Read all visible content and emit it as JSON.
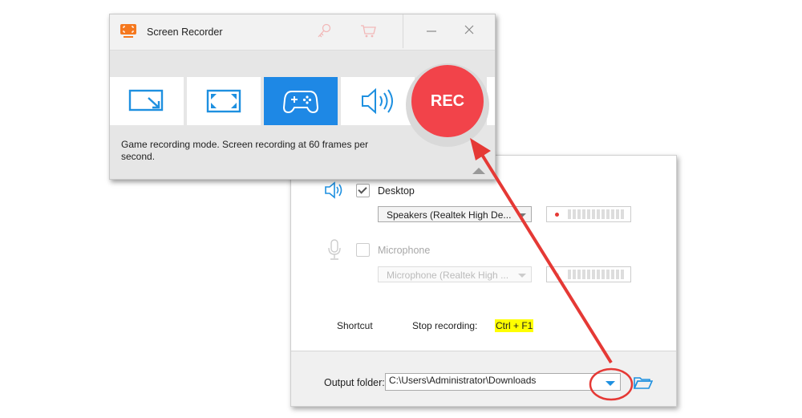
{
  "recorder": {
    "title": "Screen Recorder",
    "app_icon": "screen-recorder-logo-icon",
    "toolbar_icons": [
      "key-icon",
      "cart-icon"
    ],
    "window_controls": [
      "minimize-icon",
      "close-icon"
    ],
    "modes": [
      {
        "name": "region-mode",
        "icon": "resize-region-icon",
        "active": false
      },
      {
        "name": "fullscreen-mode",
        "icon": "fullscreen-icon",
        "active": false
      },
      {
        "name": "game-mode",
        "icon": "gamepad-icon",
        "active": true
      },
      {
        "name": "audio-only-mode",
        "icon": "speaker-icon",
        "active": false
      }
    ],
    "rec_label": "REC",
    "description": "Game recording mode. Screen recording at 60 frames per second.",
    "colors": {
      "accent": "#1e88e5",
      "rec": "#f2434a",
      "app_icon": "#f5781e"
    }
  },
  "settings": {
    "desktop": {
      "label": "Desktop",
      "checked": true,
      "device": "Speakers (Realtek High De..."
    },
    "microphone": {
      "label": "Microphone",
      "checked": false,
      "device": "Microphone (Realtek High ..."
    },
    "shortcut": {
      "label": "Shortcut",
      "action": "Stop recording:",
      "keys": "Ctrl + F1"
    },
    "output": {
      "label": "Output folder:",
      "path": "C:\\Users\\Administrator\\Downloads"
    }
  },
  "annotation": {
    "color": "#e53935",
    "note": "arrow from dropdown to REC button"
  }
}
